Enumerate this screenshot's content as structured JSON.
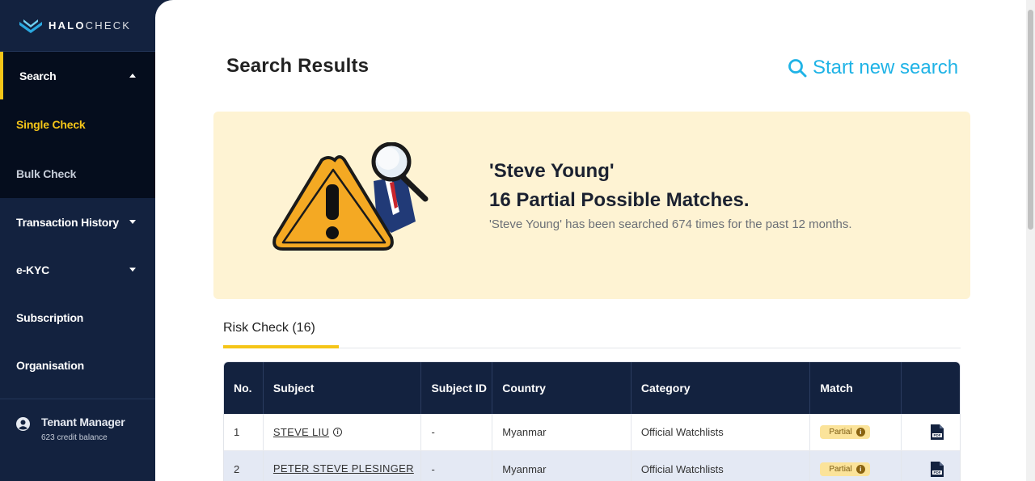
{
  "brand": {
    "bold": "HALO",
    "light": "CHECK"
  },
  "sidebar": {
    "search": {
      "label": "Search"
    },
    "sub_items": [
      {
        "label": "Single Check"
      },
      {
        "label": "Bulk Check"
      }
    ],
    "items": [
      {
        "label": "Transaction History"
      },
      {
        "label": "e-KYC"
      },
      {
        "label": "Subscription"
      },
      {
        "label": "Organisation"
      }
    ],
    "user": {
      "name": "Tenant Manager",
      "balance": "623 credit balance"
    }
  },
  "main": {
    "title": "Search Results",
    "new_search": "Start new search",
    "banner": {
      "name": "'Steve Young'",
      "matches": "16 Partial Possible Matches.",
      "note": "'Steve Young' has been searched 674 times for the past 12 months."
    },
    "tab": "Risk Check (16)",
    "table": {
      "headers": {
        "no": "No.",
        "subject": "Subject",
        "subject_id": "Subject ID",
        "country": "Country",
        "category": "Category",
        "match": "Match"
      },
      "rows": [
        {
          "no": "1",
          "subject": "STEVE LIU",
          "subject_id": "-",
          "country": "Myanmar",
          "category": "Official Watchlists",
          "match": "Partial"
        },
        {
          "no": "2",
          "subject": "PETER STEVE PLESINGER",
          "subject_id": "-",
          "country": "Myanmar",
          "category": "Official Watchlists",
          "match": "Partial"
        }
      ]
    }
  },
  "colors": {
    "sidebar_bg": "#13223f",
    "accent_yellow": "#f5c518",
    "link_blue": "#1fb3e6",
    "banner_bg": "#fef3d3"
  }
}
